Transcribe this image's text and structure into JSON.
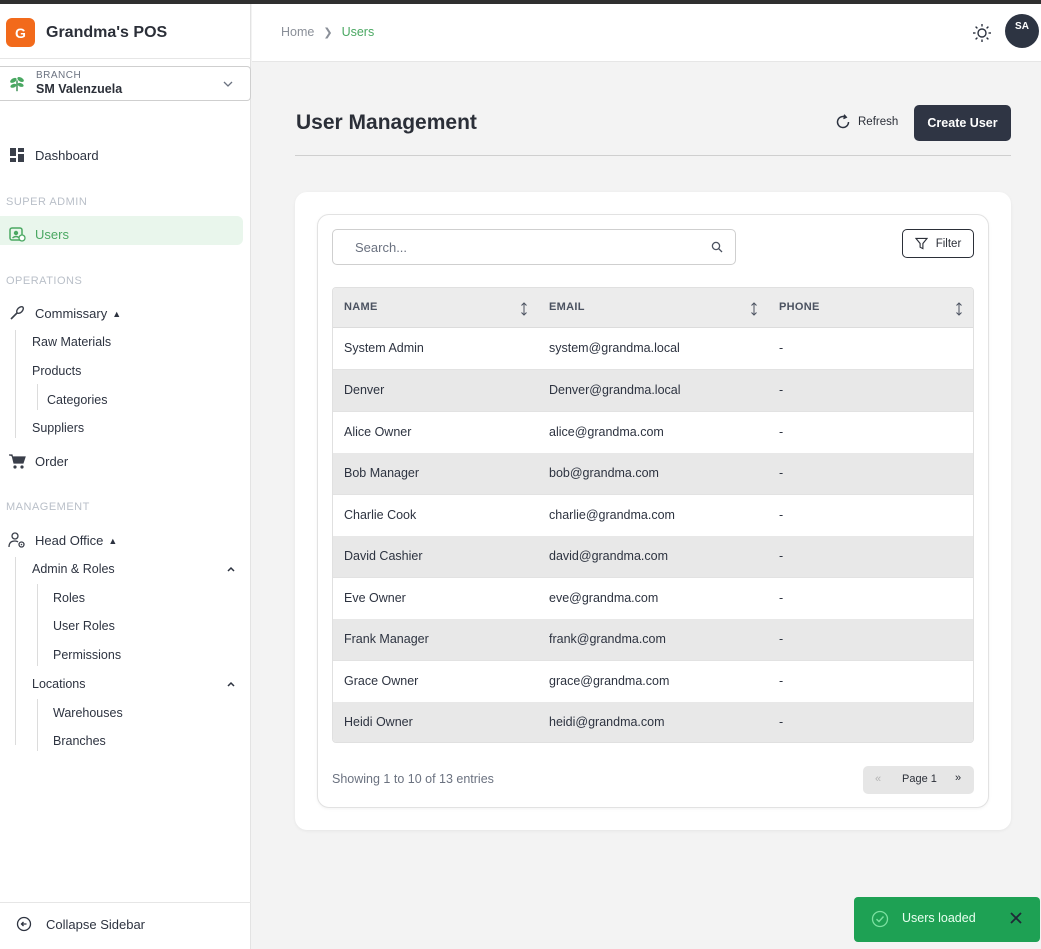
{
  "app": {
    "logo_letter": "G",
    "name": "Grandma's POS"
  },
  "branch": {
    "label": "BRANCH",
    "value": "SM Valenzuela"
  },
  "sidebar": {
    "dashboard": "Dashboard",
    "section_super_admin": "SUPER ADMIN",
    "users": "Users",
    "section_operations": "OPERATIONS",
    "commissary": "Commissary",
    "raw_materials": "Raw Materials",
    "products": "Products",
    "categories": "Categories",
    "suppliers": "Suppliers",
    "order": "Order",
    "section_management": "MANAGEMENT",
    "head_office": "Head Office",
    "admin_roles": "Admin & Roles",
    "roles": "Roles",
    "user_roles": "User Roles",
    "permissions": "Permissions",
    "locations": "Locations",
    "warehouses": "Warehouses",
    "branches": "Branches",
    "collapse": "Collapse Sidebar"
  },
  "header": {
    "breadcrumb_home": "Home",
    "breadcrumb_current": "Users",
    "avatar_initials": "SA"
  },
  "main": {
    "title": "User Management",
    "refresh_label": "Refresh",
    "create_label": "Create User",
    "search_placeholder": "Search...",
    "filter_label": "Filter"
  },
  "table": {
    "columns": [
      "NAME",
      "EMAIL",
      "PHONE"
    ],
    "rows": [
      {
        "name": "System Admin",
        "email": "system@grandma.local",
        "phone": "-"
      },
      {
        "name": "Denver",
        "email": "Denver@grandma.local",
        "phone": "-"
      },
      {
        "name": "Alice Owner",
        "email": "alice@grandma.com",
        "phone": "-"
      },
      {
        "name": "Bob Manager",
        "email": "bob@grandma.com",
        "phone": "-"
      },
      {
        "name": "Charlie Cook",
        "email": "charlie@grandma.com",
        "phone": "-"
      },
      {
        "name": "David Cashier",
        "email": "david@grandma.com",
        "phone": "-"
      },
      {
        "name": "Eve Owner",
        "email": "eve@grandma.com",
        "phone": "-"
      },
      {
        "name": "Frank Manager",
        "email": "frank@grandma.com",
        "phone": "-"
      },
      {
        "name": "Grace Owner",
        "email": "grace@grandma.com",
        "phone": "-"
      },
      {
        "name": "Heidi Owner",
        "email": "heidi@grandma.com",
        "phone": "-"
      }
    ]
  },
  "pagination": {
    "showing": "Showing 1 to 10 of 13 entries",
    "prev": "«",
    "page": "Page 1",
    "next": "»"
  },
  "toast": {
    "message": "Users loaded"
  },
  "colors": {
    "accent": "#4aa862",
    "brand": "#f26a1b",
    "dark": "#2f3544",
    "toast": "#1ea154"
  }
}
